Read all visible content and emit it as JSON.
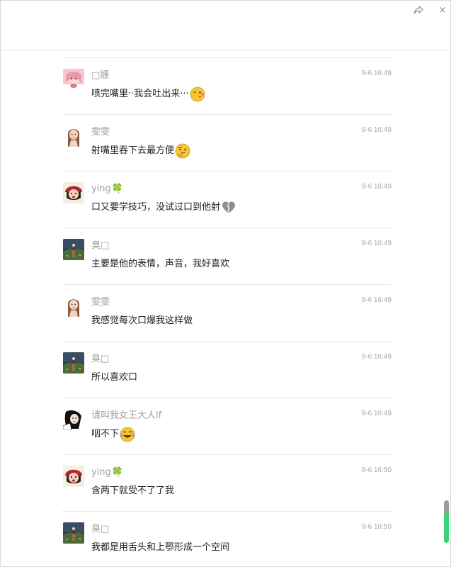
{
  "window": {
    "share_icon": "share-arrow-icon",
    "close_icon": "close-icon",
    "close_glyph": "×"
  },
  "messages": [
    {
      "sender": "□姗",
      "time": "9-6 16:49",
      "text": "喷完嘴里··我会吐出来···",
      "emoji": "face-blowing-kiss",
      "avatar": "pink"
    },
    {
      "sender": "雯雯",
      "time": "9-6 16:49",
      "text": "射嘴里吞下去最方便",
      "emoji": "thinking-face",
      "avatar": "girl"
    },
    {
      "sender": "ying",
      "time": "9-6 16:49",
      "text": "口又要学技巧，没试过口到他射",
      "emoji": "broken-heart",
      "avatar": "redhat",
      "badge": "🍀"
    },
    {
      "sender": "臭□",
      "time": "9-6 16:49",
      "text": "主要是他的表情，声音，我好喜欢",
      "emoji": "",
      "avatar": "night"
    },
    {
      "sender": "雯雯",
      "time": "9-6 16:49",
      "text": "我感觉每次口爆我这样做",
      "emoji": "",
      "avatar": "girl"
    },
    {
      "sender": "臭□",
      "time": "9-6 16:49",
      "text": "所以喜欢口",
      "emoji": "",
      "avatar": "night"
    },
    {
      "sender": "请叫我女王大人lf",
      "time": "9-6 16:49",
      "text": "咽不下",
      "emoji": "laughing-crying-face",
      "avatar": "bw"
    },
    {
      "sender": "ying",
      "time": "9-6 16:50",
      "text": "含两下就受不了了我",
      "emoji": "",
      "avatar": "redhat",
      "badge": "🍀"
    },
    {
      "sender": "臭□",
      "time": "9-6 16:50",
      "text": "我都是用舌头和上鄂形成一个空间",
      "emoji": "",
      "avatar": "night"
    }
  ],
  "colors": {
    "sender": "#a0a0a0",
    "text": "#1f1f1f",
    "time": "#a8a8a8",
    "divider": "#e8e8e8",
    "scroll_active": "#3bd17a"
  }
}
